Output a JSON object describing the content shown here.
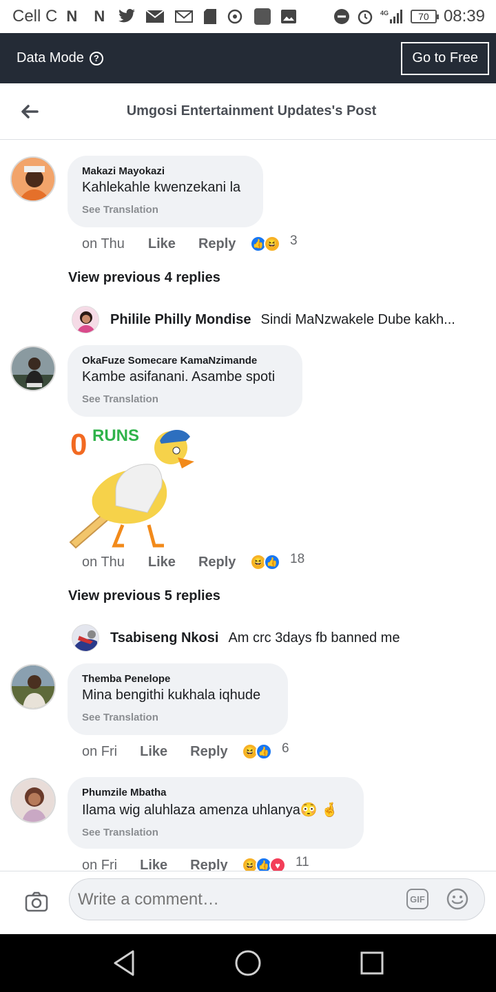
{
  "status_bar": {
    "carrier": "Cell C",
    "battery": "70",
    "time": "08:39",
    "network": "4G"
  },
  "data_bar": {
    "label": "Data Mode",
    "button": "Go to Free"
  },
  "header": {
    "title": "Umgosi Entertainment Updates's Post"
  },
  "comments": [
    {
      "name": "Makazi Mayokazi",
      "text": "Kahlekahle kwenzekani la",
      "translate": "See Translation",
      "time": "on Thu",
      "like": "Like",
      "reply": "Reply",
      "reactions": [
        "like",
        "haha"
      ],
      "count": "3"
    },
    {
      "name": "OkaFuze Somecare KamaNzimande",
      "text": "Kambe asifanani. Asambe spoti",
      "translate": "See Translation",
      "sticker_text": "0 RUNS",
      "time": "on Thu",
      "like": "Like",
      "reply": "Reply",
      "reactions": [
        "haha",
        "like"
      ],
      "count": "18"
    },
    {
      "name": "Themba Penelope",
      "text": "Mina bengithi kukhala iqhude",
      "translate": "See Translation",
      "time": "on Fri",
      "like": "Like",
      "reply": "Reply",
      "reactions": [
        "haha",
        "like"
      ],
      "count": "6"
    },
    {
      "name": "Phumzile Mbatha",
      "text": "Ilama wig aluhlaza amenza uhlanya😳 🤞",
      "translate": "See Translation",
      "time": "on Fri",
      "like": "Like",
      "reply": "Reply",
      "reactions": [
        "haha",
        "like",
        "love"
      ],
      "count": "11"
    }
  ],
  "view_previous": [
    {
      "label": "View previous 4 replies"
    },
    {
      "label": "View previous 5 replies"
    }
  ],
  "reply_previews": [
    {
      "name": "Philile Philly Mondise",
      "text": "Sindi MaNzwakele Dube kakh..."
    },
    {
      "name": "Tsabiseng Nkosi",
      "text": "Am crc 3days fb banned me"
    }
  ],
  "composer": {
    "placeholder": "Write a comment…",
    "gif_label": "GIF"
  },
  "colors": {
    "data_bar_bg": "#242b36",
    "bubble_bg": "#f0f2f5",
    "like_blue": "#1877f2",
    "haha_yellow": "#f7b125",
    "love_red": "#f33e58"
  },
  "icons": [
    "back-arrow-icon",
    "help-icon",
    "camera-icon",
    "gif-icon",
    "emoji-icon",
    "nav-back-icon",
    "nav-home-icon",
    "nav-recents-icon"
  ]
}
